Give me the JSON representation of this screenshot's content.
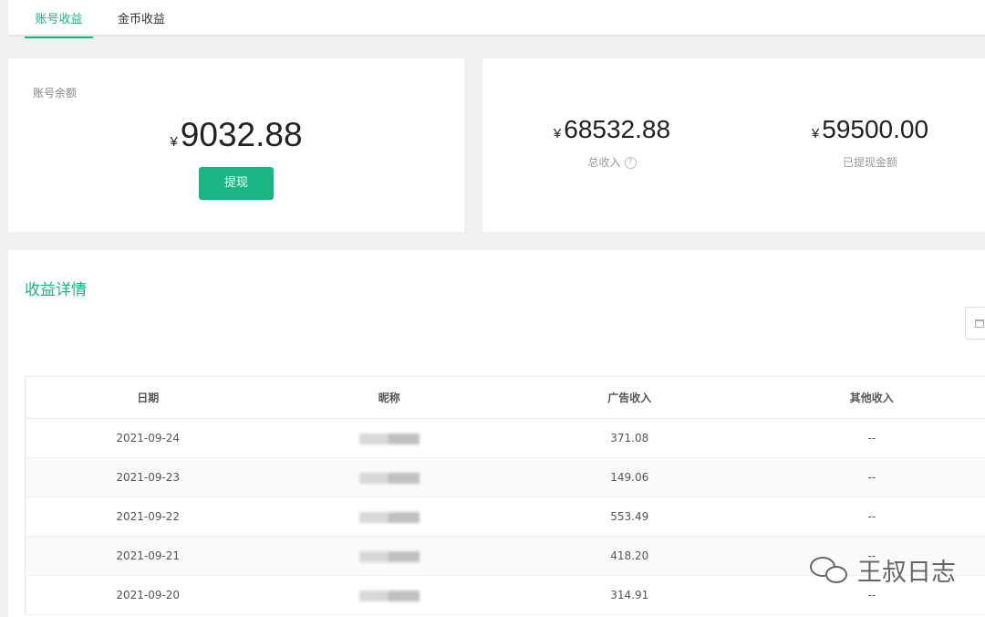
{
  "tabs": [
    {
      "label": "账号收益",
      "active": true
    },
    {
      "label": "金币收益",
      "active": false
    }
  ],
  "balance": {
    "label": "账号余额",
    "currency": "¥",
    "amount": "9032.88",
    "withdraw_label": "提现"
  },
  "summary": {
    "total": {
      "currency": "¥",
      "amount": "68532.88",
      "label": "总收入",
      "help_icon": "question-circle-icon"
    },
    "withdrawn": {
      "currency": "¥",
      "amount": "59500.00",
      "label": "已提现金额"
    }
  },
  "details": {
    "title": "收益详情",
    "date_picker_icon": "calendar-icon",
    "columns": [
      "日期",
      "昵称",
      "广告收入",
      "其他收入"
    ],
    "rows": [
      {
        "date": "2021-09-24",
        "ad": "371.08",
        "other": "--"
      },
      {
        "date": "2021-09-23",
        "ad": "149.06",
        "other": "--"
      },
      {
        "date": "2021-09-22",
        "ad": "553.49",
        "other": "--"
      },
      {
        "date": "2021-09-21",
        "ad": "418.20",
        "other": "--"
      },
      {
        "date": "2021-09-20",
        "ad": "314.91",
        "other": "--"
      }
    ]
  },
  "watermark": {
    "text": "王叔日志",
    "icon": "wechat-icon"
  },
  "colors": {
    "accent": "#19b684",
    "background": "#f0f0f0"
  }
}
